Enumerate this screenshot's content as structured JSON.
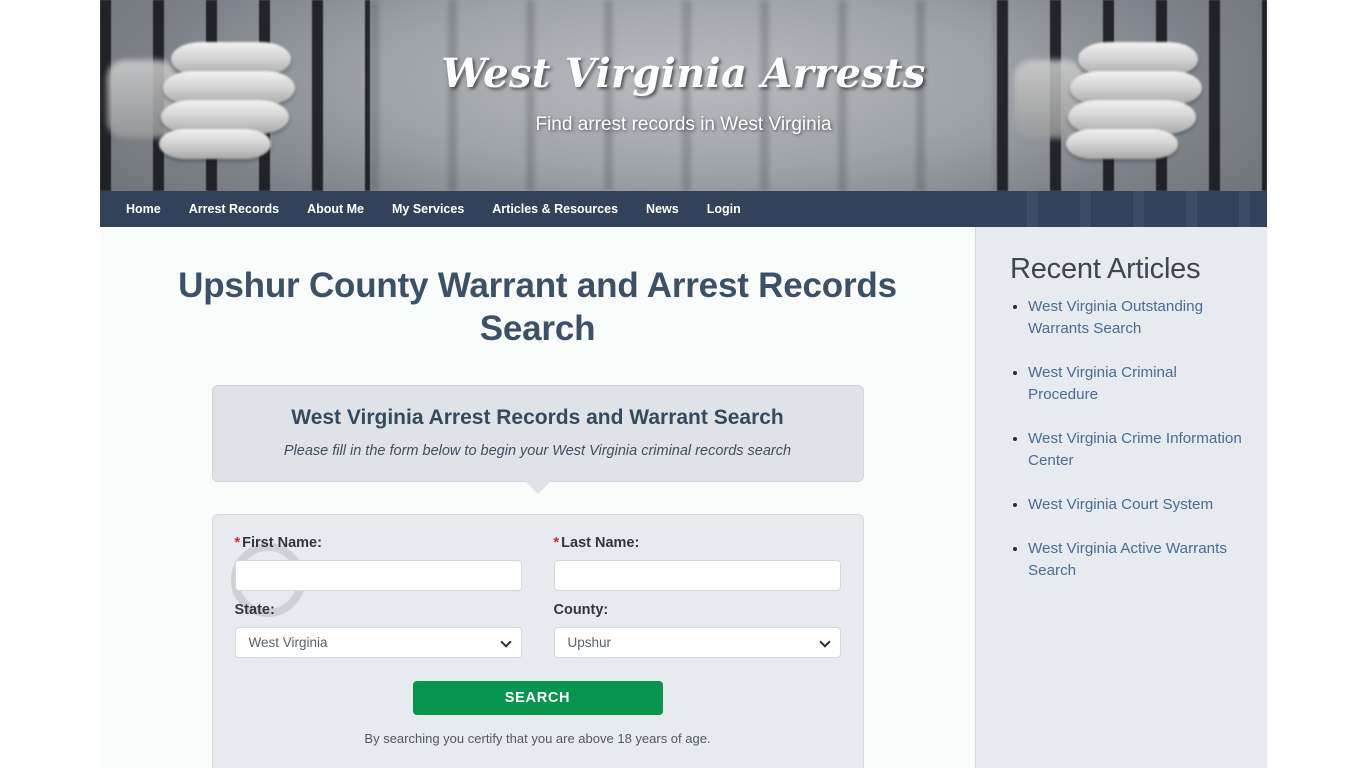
{
  "banner": {
    "site_title": "West Virginia Arrests",
    "tagline": "Find arrest records in West Virginia"
  },
  "nav": {
    "items": [
      {
        "label": "Home"
      },
      {
        "label": "Arrest Records"
      },
      {
        "label": "About Me"
      },
      {
        "label": "My Services"
      },
      {
        "label": "Articles & Resources"
      },
      {
        "label": "News"
      },
      {
        "label": "Login"
      }
    ]
  },
  "main": {
    "page_title": "Upshur County Warrant and Arrest Records Search",
    "promo": {
      "title": "West Virginia Arrest Records and Warrant Search",
      "subtitle": "Please fill in the form below to begin your West Virginia criminal records search"
    },
    "form": {
      "required_marker": "*",
      "first_name_label": "First Name:",
      "first_name_value": "",
      "first_name_placeholder": "",
      "last_name_label": "Last Name:",
      "last_name_value": "",
      "last_name_placeholder": "",
      "state_label": "State:",
      "state_value": "West Virginia",
      "county_label": "County:",
      "county_value": "Upshur",
      "search_button": "SEARCH",
      "certify_text": "By searching you certify that you are above 18 years of age."
    }
  },
  "sidebar": {
    "title": "Recent Articles",
    "articles": [
      {
        "label": "West Virginia Outstanding Warrants Search"
      },
      {
        "label": "West Virginia Criminal Procedure"
      },
      {
        "label": "West Virginia Crime Information Center"
      },
      {
        "label": "West Virginia Court System"
      },
      {
        "label": "West Virginia Active Warrants Search"
      }
    ]
  },
  "colors": {
    "nav_background": "#1b2d47",
    "heading": "#3c5068",
    "link": "#4a6c97",
    "button_green": "#07944f",
    "required_red": "#d9262c",
    "panel_background": "#e7eaee",
    "promo_background": "#dfe3e8"
  }
}
